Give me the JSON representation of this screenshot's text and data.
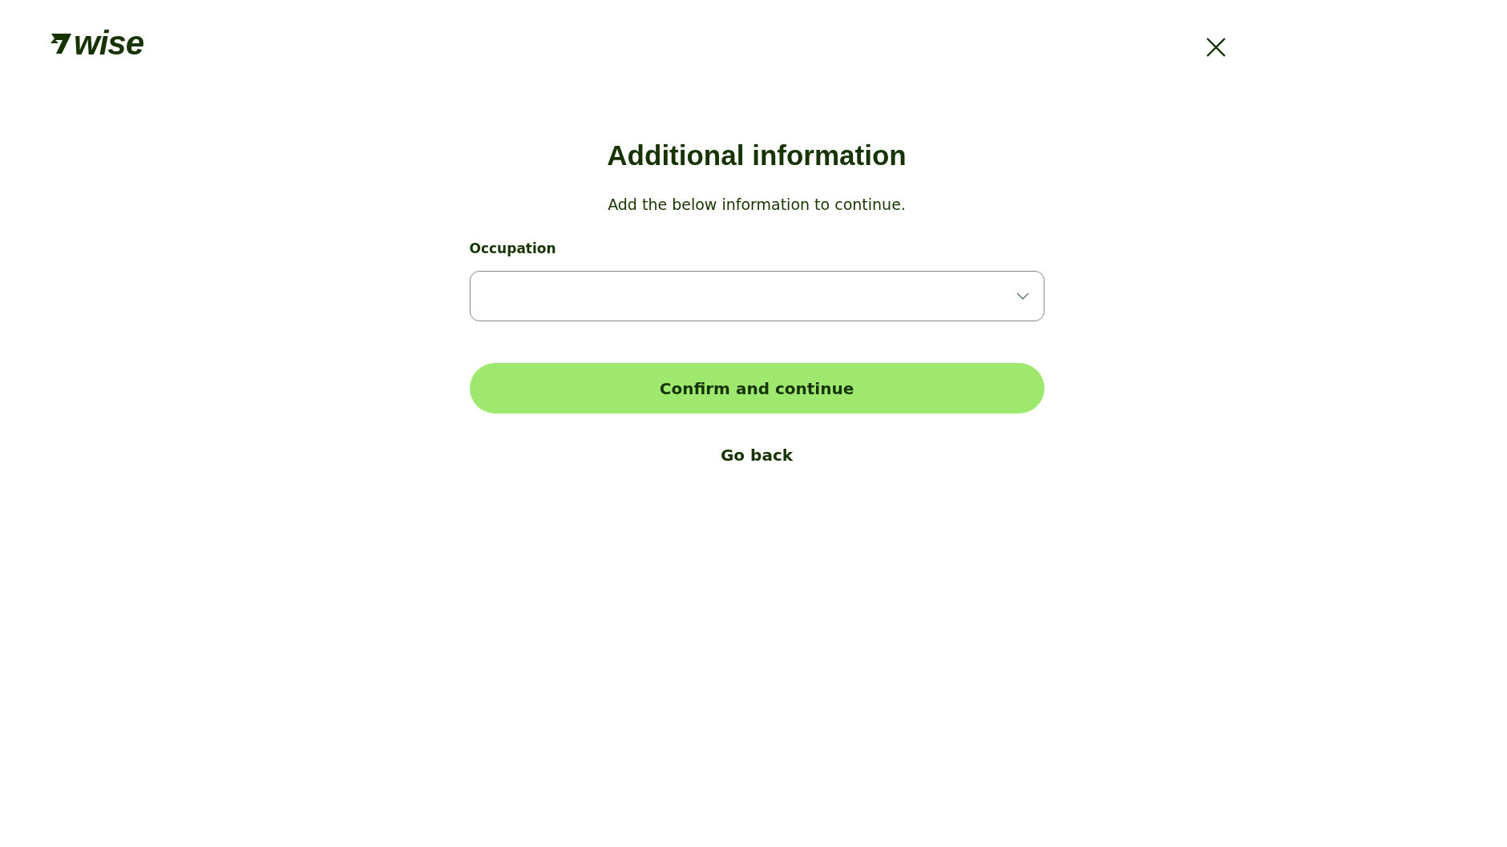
{
  "header": {
    "logo_text": "wise"
  },
  "form": {
    "title": "Additional information",
    "subtitle": "Add the below information to continue.",
    "fields": [
      {
        "label": "Occupation",
        "kind": "select"
      }
    ],
    "primary_button": "Confirm and continue",
    "back_link": "Go back"
  }
}
